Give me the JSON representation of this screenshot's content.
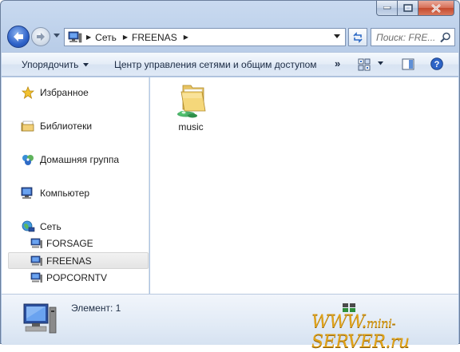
{
  "window": {
    "caption_buttons": [
      "minimize",
      "maximize",
      "close"
    ]
  },
  "navbar": {
    "breadcrumbs": [
      "Сеть",
      "FREENAS"
    ],
    "search_placeholder": "Поиск: FRE..."
  },
  "toolbar": {
    "organize_label": "Упорядочить",
    "network_center_label": "Центр управления сетями и общим доступом",
    "more_label": "»"
  },
  "sidebar": {
    "favorites": "Избранное",
    "libraries": "Библиотеки",
    "homegroup": "Домашняя группа",
    "computer": "Компьютер",
    "network": "Сеть",
    "network_items": [
      {
        "label": "FORSAGE"
      },
      {
        "label": "FREENAS",
        "selected": true
      },
      {
        "label": "POPCORNTV"
      }
    ]
  },
  "content": {
    "items": [
      {
        "label": "music",
        "type": "shared-folder",
        "icon": "shared-folder-icon"
      }
    ]
  },
  "details": {
    "count_text": "Элемент: 1",
    "watermark_main": "WWW.",
    "watermark_mid": "mini-",
    "watermark_brand": "SERVER.ru"
  },
  "colors": {
    "accent": "#2f63c9",
    "watermark": "#e0a31b",
    "close_button": "#c44a2e"
  }
}
